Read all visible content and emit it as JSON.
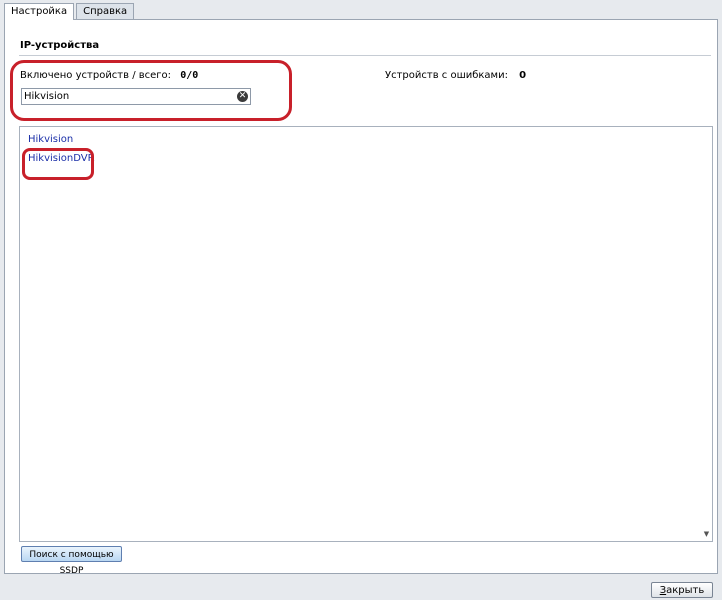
{
  "tabs": [
    {
      "label": "Настройка",
      "active": true
    },
    {
      "label": "Справка",
      "active": false
    }
  ],
  "section": {
    "title": "IP-устройства"
  },
  "stats": {
    "enabled_label": "Включено устройств / всего:",
    "enabled_value": "0/0",
    "errors_label": "Устройств с ошибками:",
    "errors_value": "0"
  },
  "filter": {
    "value": "Hikvision",
    "clear_icon": "clear-circle-icon"
  },
  "devices": [
    {
      "label": "Hikvision"
    },
    {
      "label": "HikvisionDVR"
    }
  ],
  "buttons": {
    "ssdp_search": "Поиск с помощью SSDP",
    "close_accel": "З",
    "close_rest": "акрыть"
  },
  "colors": {
    "annotation": "#c8202a",
    "link": "#1b2fa8"
  }
}
